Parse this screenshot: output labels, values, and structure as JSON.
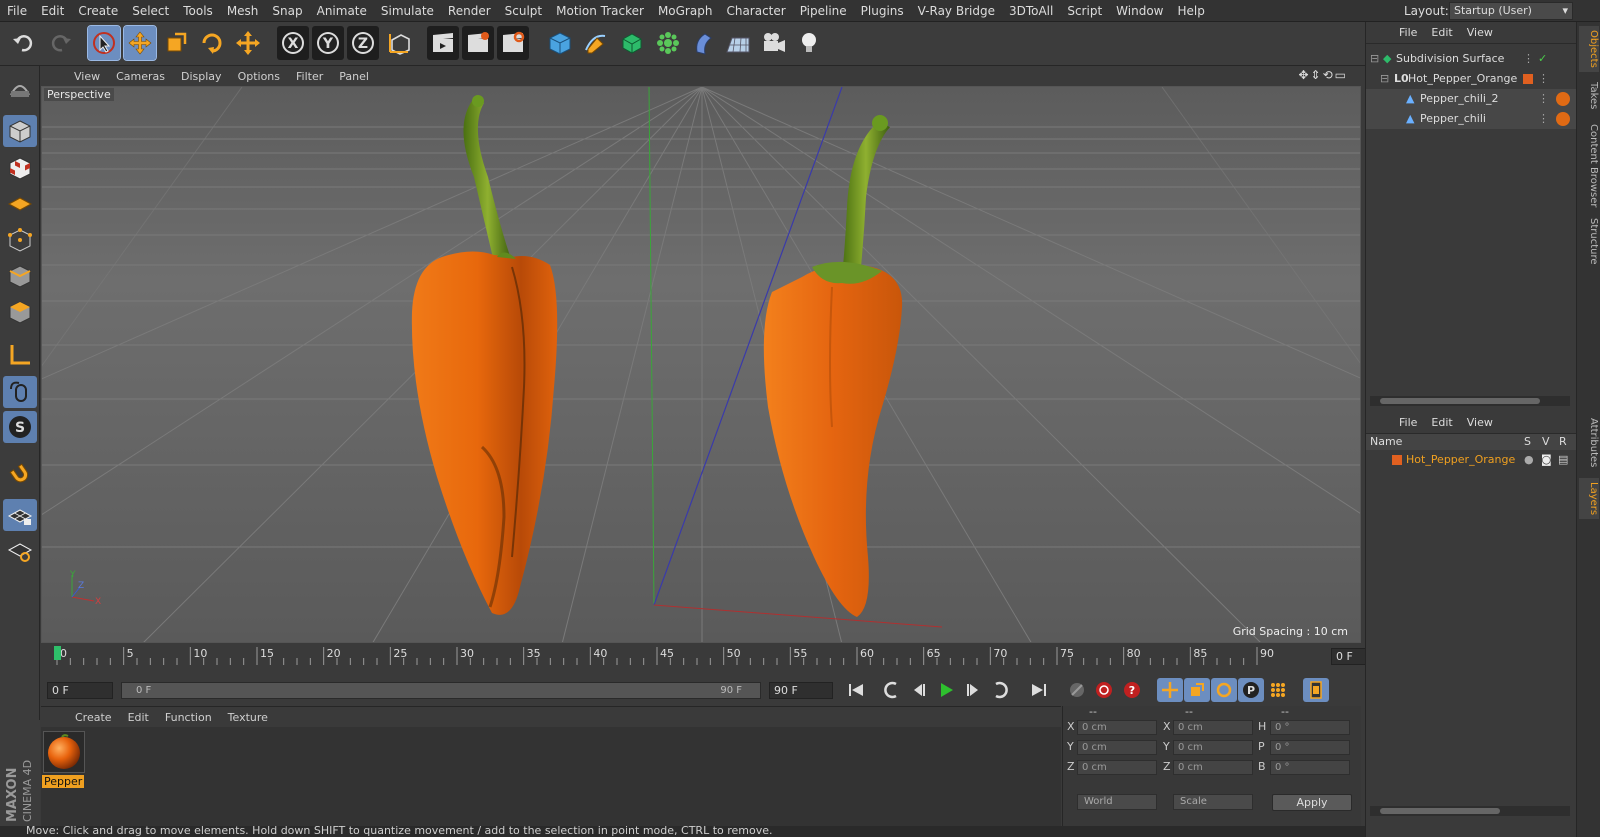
{
  "menubar": {
    "items": [
      "File",
      "Edit",
      "Create",
      "Select",
      "Tools",
      "Mesh",
      "Snap",
      "Animate",
      "Simulate",
      "Render",
      "Sculpt",
      "Motion Tracker",
      "MoGraph",
      "Character",
      "Pipeline",
      "Plugins",
      "V-Ray Bridge",
      "3DToAll",
      "Script",
      "Window",
      "Help"
    ],
    "layout_label": "Layout:",
    "layout_value": "Startup (User)"
  },
  "viewport": {
    "menu": [
      "View",
      "Cameras",
      "Display",
      "Options",
      "Filter",
      "Panel"
    ],
    "camera_label": "Perspective",
    "grid_spacing": "Grid Spacing : 10 cm",
    "axis_y": "Y",
    "axis_z": "Z",
    "axis_x": "X"
  },
  "timeline": {
    "ticks": [
      "0",
      "5",
      "10",
      "15",
      "20",
      "25",
      "30",
      "35",
      "40",
      "45",
      "50",
      "55",
      "60",
      "65",
      "70",
      "75",
      "80",
      "85",
      "90"
    ],
    "current_frame": "0 F"
  },
  "transport": {
    "start_frame": "0 F",
    "range_start": "0 F",
    "range_end": "90 F",
    "end_frame": "90 F"
  },
  "material_manager": {
    "menu": [
      "Create",
      "Edit",
      "Function",
      "Texture"
    ],
    "material_name": "Pepper"
  },
  "coordinates": {
    "header": [
      "--",
      "--",
      "--"
    ],
    "rows": [
      {
        "l1": "X",
        "v1": "0 cm",
        "l2": "X",
        "v2": "0 cm",
        "l3": "H",
        "v3": "0 °"
      },
      {
        "l1": "Y",
        "v1": "0 cm",
        "l2": "Y",
        "v2": "0 cm",
        "l3": "P",
        "v3": "0 °"
      },
      {
        "l1": "Z",
        "v1": "0 cm",
        "l2": "Z",
        "v2": "0 cm",
        "l3": "B",
        "v3": "0 °"
      }
    ],
    "space_select": "World",
    "mode_select": "Scale",
    "apply_label": "Apply"
  },
  "branding": {
    "maxon": "MAXON",
    "cinema": "CINEMA 4D"
  },
  "status": {
    "text": "Move: Click and drag to move elements. Hold down SHIFT to quantize movement / add to the selection in point mode, CTRL to remove."
  },
  "object_manager": {
    "menu": [
      "File",
      "Edit",
      "View"
    ],
    "objects": [
      {
        "name": "Subdivision Surface"
      },
      {
        "name": "Hot_Pepper_Orange"
      },
      {
        "name": "Pepper_chili_2"
      },
      {
        "name": "Pepper_chili"
      }
    ]
  },
  "layer_manager": {
    "menu": [
      "File",
      "Edit",
      "View"
    ],
    "col_name": "Name",
    "col_s": "S",
    "col_v": "V",
    "col_r": "R",
    "layers": [
      {
        "name": "Hot_Pepper_Orange",
        "color": "#e06020"
      }
    ]
  },
  "side_tabs": [
    "Objects",
    "Takes",
    "Content Browser",
    "Structure",
    "Attributes",
    "Layers"
  ],
  "colors": {
    "accent": "#f0a020",
    "highlight": "#6c8ec0",
    "pepper": "#e86a12",
    "stem": "#5f8a1e"
  }
}
